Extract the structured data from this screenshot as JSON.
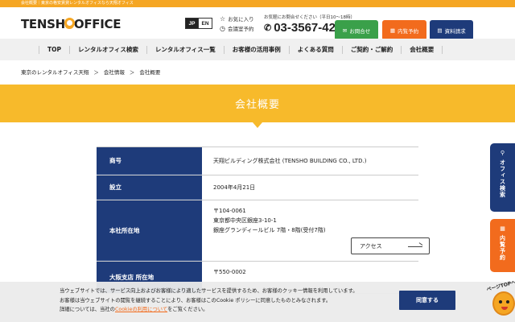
{
  "topbar": {
    "text": "会社概要｜東京の格安賃貸レンタルオフィスなら天翔オフィス"
  },
  "header": {
    "logo_left": "TENSH",
    "logo_right": "OFFICE",
    "lang_jp": "JP",
    "lang_en": "EN",
    "favorites": "お気に入り",
    "meeting_room": "会議室予約",
    "tel_note": "お気軽にお問合せください（平日10〜18時）",
    "tel": "03-3567-4211",
    "btn_contact": "お問合せ",
    "btn_visit": "内覧予約",
    "btn_docs": "資料請求"
  },
  "nav": [
    "TOP",
    "レンタルオフィス検索",
    "レンタルオフィス一覧",
    "お客様の活用事例",
    "よくある質問",
    "ご契約・ご解約",
    "会社概要"
  ],
  "breadcrumb": [
    "東京のレンタルオフィス天翔",
    "＞",
    "会社情報",
    "＞",
    "会社概要"
  ],
  "hero": {
    "title": "会社概要"
  },
  "table": {
    "rows": [
      {
        "label": "商号",
        "lines": [
          "天翔ビルディング株式会社 (TENSHO BUILDING CO., LTD.)"
        ]
      },
      {
        "label": "設立",
        "lines": [
          "2004年4月21日"
        ]
      },
      {
        "label": "本社所在地",
        "lines": [
          "〒104-0061",
          "東京都中央区銀座3-10-1",
          "銀座グランディールビル 7階・8階(受付7階)"
        ]
      },
      {
        "label": "大阪支店 所在地",
        "lines": [
          "〒550-0002"
        ]
      }
    ],
    "access_label": "アクセス"
  },
  "side": {
    "search": "オフィス検索",
    "visit": "内覧予約"
  },
  "cookie": {
    "line1": "当ウェブサイトでは、サービス向上およびお客様により適したサービスを提供するため、お客様のクッキー情報を利用しています。",
    "line2": "お客様は当ウェブサイトの閲覧を継続することにより、お客様はこのCookie ポリシーに同意したものとみなされます。",
    "line3_pre": "詳細については、当社の",
    "line3_link": "Cookieの利用について",
    "line3_post": "をご覧ください。",
    "agree": "同意する"
  },
  "pagetop": {
    "label": "ページTOPへ"
  },
  "colors": {
    "accent": "#f7ba2b",
    "navy": "#1e3b7a",
    "green": "#3aa04a",
    "orange": "#f26b1d"
  }
}
